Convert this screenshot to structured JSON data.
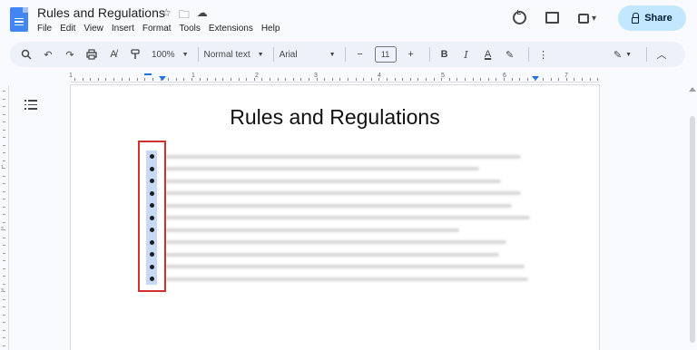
{
  "window": {
    "doc_title": "Rules and Regulations"
  },
  "menu": [
    "File",
    "Edit",
    "View",
    "Insert",
    "Format",
    "Tools",
    "Extensions",
    "Help"
  ],
  "header": {
    "share_label": "Share",
    "icons": [
      "star-icon",
      "move-folder-icon",
      "cloud-saved-icon",
      "history-icon",
      "comment-icon",
      "meet-icon",
      "lock-icon"
    ]
  },
  "toolbar": {
    "zoom": "100%",
    "style": "Normal text",
    "font": "Arial",
    "font_size": "11",
    "minus": "−",
    "plus": "+",
    "bold": "B",
    "italic": "I",
    "text_color": "A"
  },
  "ruler": {
    "numbers": [
      "1",
      "1",
      "2",
      "3",
      "4",
      "5",
      "6",
      "7"
    ]
  },
  "vertical_ruler": {
    "numbers": [
      "1",
      "2",
      "3"
    ]
  },
  "document": {
    "heading": "Rules and Regulations",
    "bullet_count": 11
  },
  "colors": {
    "accent": "#1a73e8",
    "share_bg": "#c2e7ff",
    "highlight_box": "#d32f2f",
    "toolbar_bg": "#edf2fa",
    "doc_icon": "#4285f4"
  }
}
